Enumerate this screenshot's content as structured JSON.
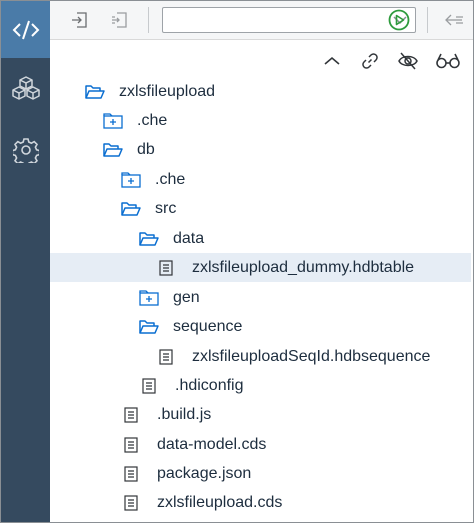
{
  "activity_bar": {
    "items": [
      {
        "name": "code-editor",
        "icon": "code-icon",
        "active": true
      },
      {
        "name": "explorer",
        "icon": "cubes-icon",
        "active": false
      },
      {
        "name": "settings",
        "icon": "gear-icon",
        "active": false
      }
    ]
  },
  "toolbar": {
    "select_value": "",
    "accent_color": "#2e9b3d"
  },
  "tree": {
    "items": [
      {
        "label": "zxlsfileupload",
        "type": "folder-open"
      },
      {
        "label": ".che",
        "type": "folder-closed"
      },
      {
        "label": "db",
        "type": "folder-open"
      },
      {
        "label": ".che",
        "type": "folder-closed"
      },
      {
        "label": "src",
        "type": "folder-open"
      },
      {
        "label": "data",
        "type": "folder-open"
      },
      {
        "label": "zxlsfileupload_dummy.hdbtable",
        "type": "file",
        "selected": true
      },
      {
        "label": "gen",
        "type": "folder-closed"
      },
      {
        "label": "sequence",
        "type": "folder-open"
      },
      {
        "label": "zxlsfileuploadSeqId.hdbsequence",
        "type": "file"
      },
      {
        "label": ".hdiconfig",
        "type": "file"
      },
      {
        "label": ".build.js",
        "type": "file"
      },
      {
        "label": "data-model.cds",
        "type": "file"
      },
      {
        "label": "package.json",
        "type": "file"
      },
      {
        "label": "zxlsfileupload.cds",
        "type": "file"
      }
    ]
  },
  "colors": {
    "sidebar": "#354a5f",
    "sidebar_active": "#4a7ba8",
    "folder_icon": "#0a6ed1",
    "selection": "#e6edf5"
  }
}
